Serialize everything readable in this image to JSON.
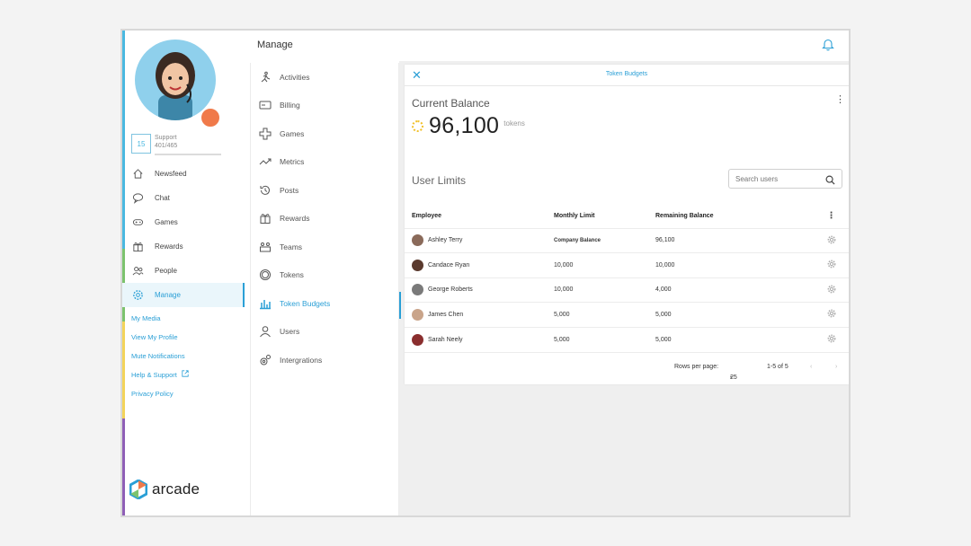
{
  "sidebar": {
    "level": "15",
    "support_label": "Support",
    "points": "401/465",
    "nav": [
      {
        "label": "Newsfeed",
        "icon": "home-icon"
      },
      {
        "label": "Chat",
        "icon": "chat-icon"
      },
      {
        "label": "Games",
        "icon": "gamepad-icon"
      },
      {
        "label": "Rewards",
        "icon": "gift-icon"
      },
      {
        "label": "People",
        "icon": "people-icon"
      },
      {
        "label": "Manage",
        "icon": "gear-icon"
      }
    ],
    "links": [
      "My Media",
      "View My Profile",
      "Mute Notifications",
      "Help & Support",
      "Privacy Policy"
    ],
    "logo_text": "arcade"
  },
  "header": {
    "title": "Manage"
  },
  "manage_menu": [
    {
      "label": "Activities",
      "icon": "activity-icon"
    },
    {
      "label": "Billing",
      "icon": "card-icon"
    },
    {
      "label": "Games",
      "icon": "puzzle-icon"
    },
    {
      "label": "Metrics",
      "icon": "trend-icon"
    },
    {
      "label": "Posts",
      "icon": "history-icon"
    },
    {
      "label": "Rewards",
      "icon": "gift-icon"
    },
    {
      "label": "Teams",
      "icon": "team-icon"
    },
    {
      "label": "Tokens",
      "icon": "token-icon"
    },
    {
      "label": "Token Budgets",
      "icon": "bar-chart-icon"
    },
    {
      "label": "Users",
      "icon": "user-icon"
    },
    {
      "label": "Intergrations",
      "icon": "plugin-icon"
    }
  ],
  "panel": {
    "title": "Token Budgets",
    "current_balance_label": "Current Balance",
    "balance": "96,100",
    "balance_unit": "tokens",
    "user_limits_label": "User Limits",
    "search_placeholder": "Search users",
    "columns": [
      "Employee",
      "Monthly Limit",
      "Remaining Balance"
    ],
    "rows": [
      {
        "name": "Ashley Terry",
        "limit": "Company Balance",
        "remaining": "96,100",
        "face": "#8a6a5a"
      },
      {
        "name": "Candace Ryan",
        "limit": "10,000",
        "remaining": "10,000",
        "face": "#5a3a2e"
      },
      {
        "name": "George Roberts",
        "limit": "10,000",
        "remaining": "4,000",
        "face": "#7a7a7a"
      },
      {
        "name": "James Chen",
        "limit": "5,000",
        "remaining": "5,000",
        "face": "#c9a48a"
      },
      {
        "name": "Sarah Neely",
        "limit": "5,000",
        "remaining": "5,000",
        "face": "#8a2e2e"
      }
    ],
    "rows_per_page_label": "Rows per page:",
    "rows_per_page": "25",
    "range": "1-5 of 5"
  },
  "colors": {
    "accent": "#2a9fd6",
    "coin": "#f1c12e"
  }
}
